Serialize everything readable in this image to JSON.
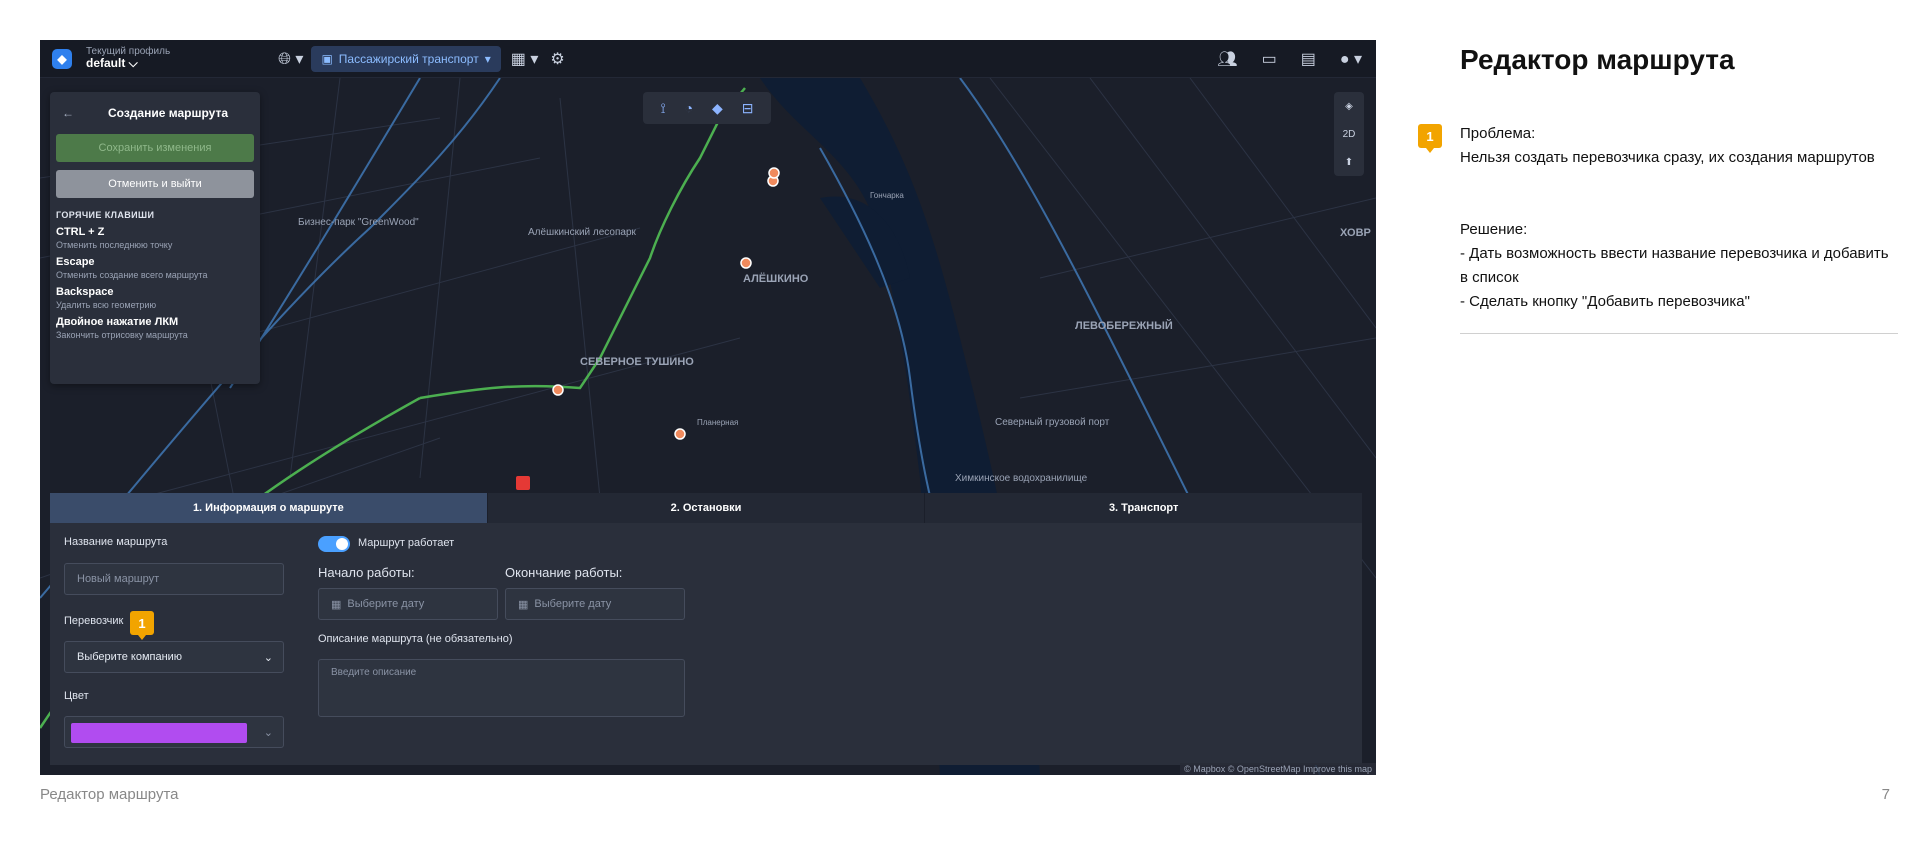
{
  "topbar": {
    "profile_label": "Текущий профиль",
    "profile_value": "default ⌵",
    "transport_label": "Пассажирский транспорт"
  },
  "side_panel": {
    "title": "Создание маршрута",
    "save_button": "Сохранить изменения",
    "cancel_button": "Отменить и выйти",
    "hotkeys_title": "ГОРЯЧИЕ КЛАВИШИ",
    "hotkeys": [
      {
        "key": "CTRL + Z",
        "desc": "Отменить последнюю точку"
      },
      {
        "key": "Escape",
        "desc": "Отменить создание всего маршрута"
      },
      {
        "key": "Backspace",
        "desc": "Удалить всю геометрию"
      },
      {
        "key": "Двойное нажатие ЛКМ",
        "desc": "Закончить отрисовку маршрута"
      }
    ]
  },
  "map": {
    "labels": [
      "Бизнес-парк \"GreenWood\"",
      "Алёшкинский лесопарк",
      "АЛЁШКИНО",
      "СЕВЕРНОЕ ТУШИНО",
      "Планерная",
      "ЛЕВОБЕРЕЖНЫЙ",
      "Северный грузовой порт",
      "Химкинское водохранилище",
      "ХОВР",
      "Гончарка"
    ],
    "ctrl_2d": "2D",
    "attribution": "© Mapbox © OpenStreetMap Improve this map"
  },
  "form": {
    "tabs": [
      "1. Информация о маршруте",
      "2. Остановки",
      "3. Транспорт"
    ],
    "route_name_label": "Название маршрута",
    "route_name_placeholder": "Новый маршрут",
    "carrier_label": "Перевозчик",
    "carrier_value": "Выберите компанию",
    "color_label": "Цвет",
    "color_value": "#b14cf0",
    "working_toggle_label": "Маршрут работает",
    "start_label": "Начало работы:",
    "end_label": "Окончание работы:",
    "date_placeholder": "Выберите дату",
    "description_label": "Описание маршрута (не обязательно)",
    "description_placeholder": "Введите описание"
  },
  "marker_number": "1",
  "notes": {
    "title": "Редактор маршрута",
    "problem_label": "Проблема:",
    "problem_text": "Нельзя создать перевозчика сразу, их создания маршрутов",
    "solution_label": "Решение:",
    "solution_items": [
      "- Дать возможность ввести название перевозчика и добавить в список",
      "- Сделать кнопку \"Добавить перевозчика\""
    ]
  },
  "footer": {
    "left": "Редактор маршрута",
    "page_number": "7"
  },
  "colors": {
    "accent": "#f2a400",
    "route_green": "#4caf50",
    "map_bg": "#1b1f2a",
    "water": "#0f1d33"
  }
}
